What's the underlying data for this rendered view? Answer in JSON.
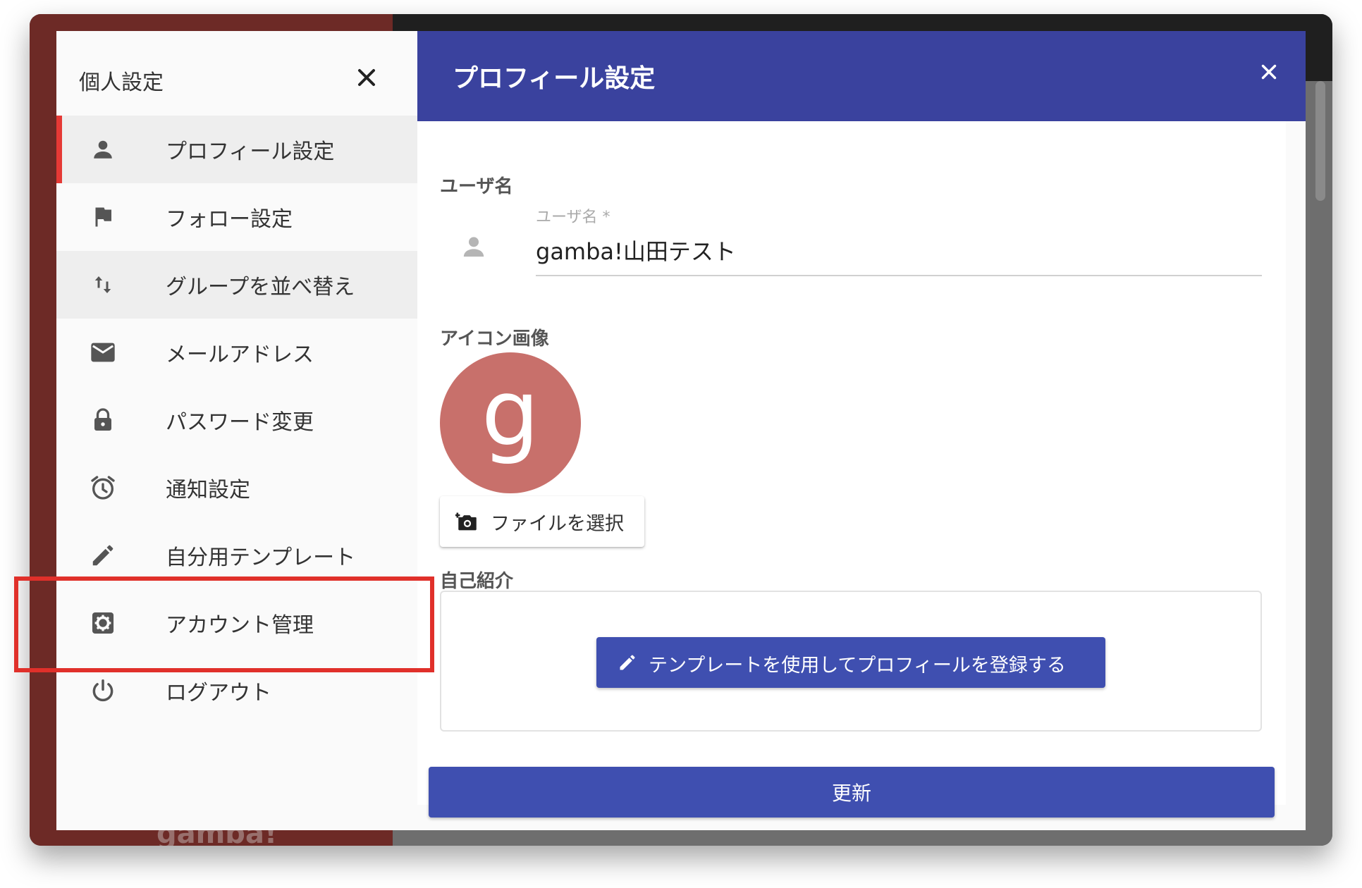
{
  "background": {
    "brand_text": "gamba!"
  },
  "drawer": {
    "title": "個人設定",
    "close_icon": "close-icon",
    "items": [
      {
        "label": "プロフィール設定",
        "icon": "person-icon"
      },
      {
        "label": "フォロー設定",
        "icon": "flag-icon"
      },
      {
        "label": "グループを並べ替え",
        "icon": "sort-arrows-icon"
      },
      {
        "label": "メールアドレス",
        "icon": "mail-icon"
      },
      {
        "label": "パスワード変更",
        "icon": "lock-icon"
      },
      {
        "label": "通知設定",
        "icon": "alarm-icon"
      },
      {
        "label": "自分用テンプレート",
        "icon": "pencil-icon"
      },
      {
        "label": "アカウント管理",
        "icon": "gear-icon"
      },
      {
        "label": "ログアウト",
        "icon": "power-icon"
      }
    ]
  },
  "dialog": {
    "title": "プロフィール設定",
    "close_icon": "close-icon",
    "username_section": "ユーザ名",
    "username_field_label": "ユーザ名 *",
    "username_value": "gamba!山田テスト",
    "icon_section": "アイコン画像",
    "avatar_letter": "g",
    "avatar_color": "#c8706b",
    "file_button": "ファイルを選択",
    "intro_section": "自己紹介",
    "template_button": "テンプレートを使用してプロフィールを登録する",
    "update_button": "更新"
  },
  "colors": {
    "header": "#3a429e",
    "primary_button": "#3f4fb0",
    "active_indicator": "#e53935",
    "highlight": "#e0302a"
  }
}
